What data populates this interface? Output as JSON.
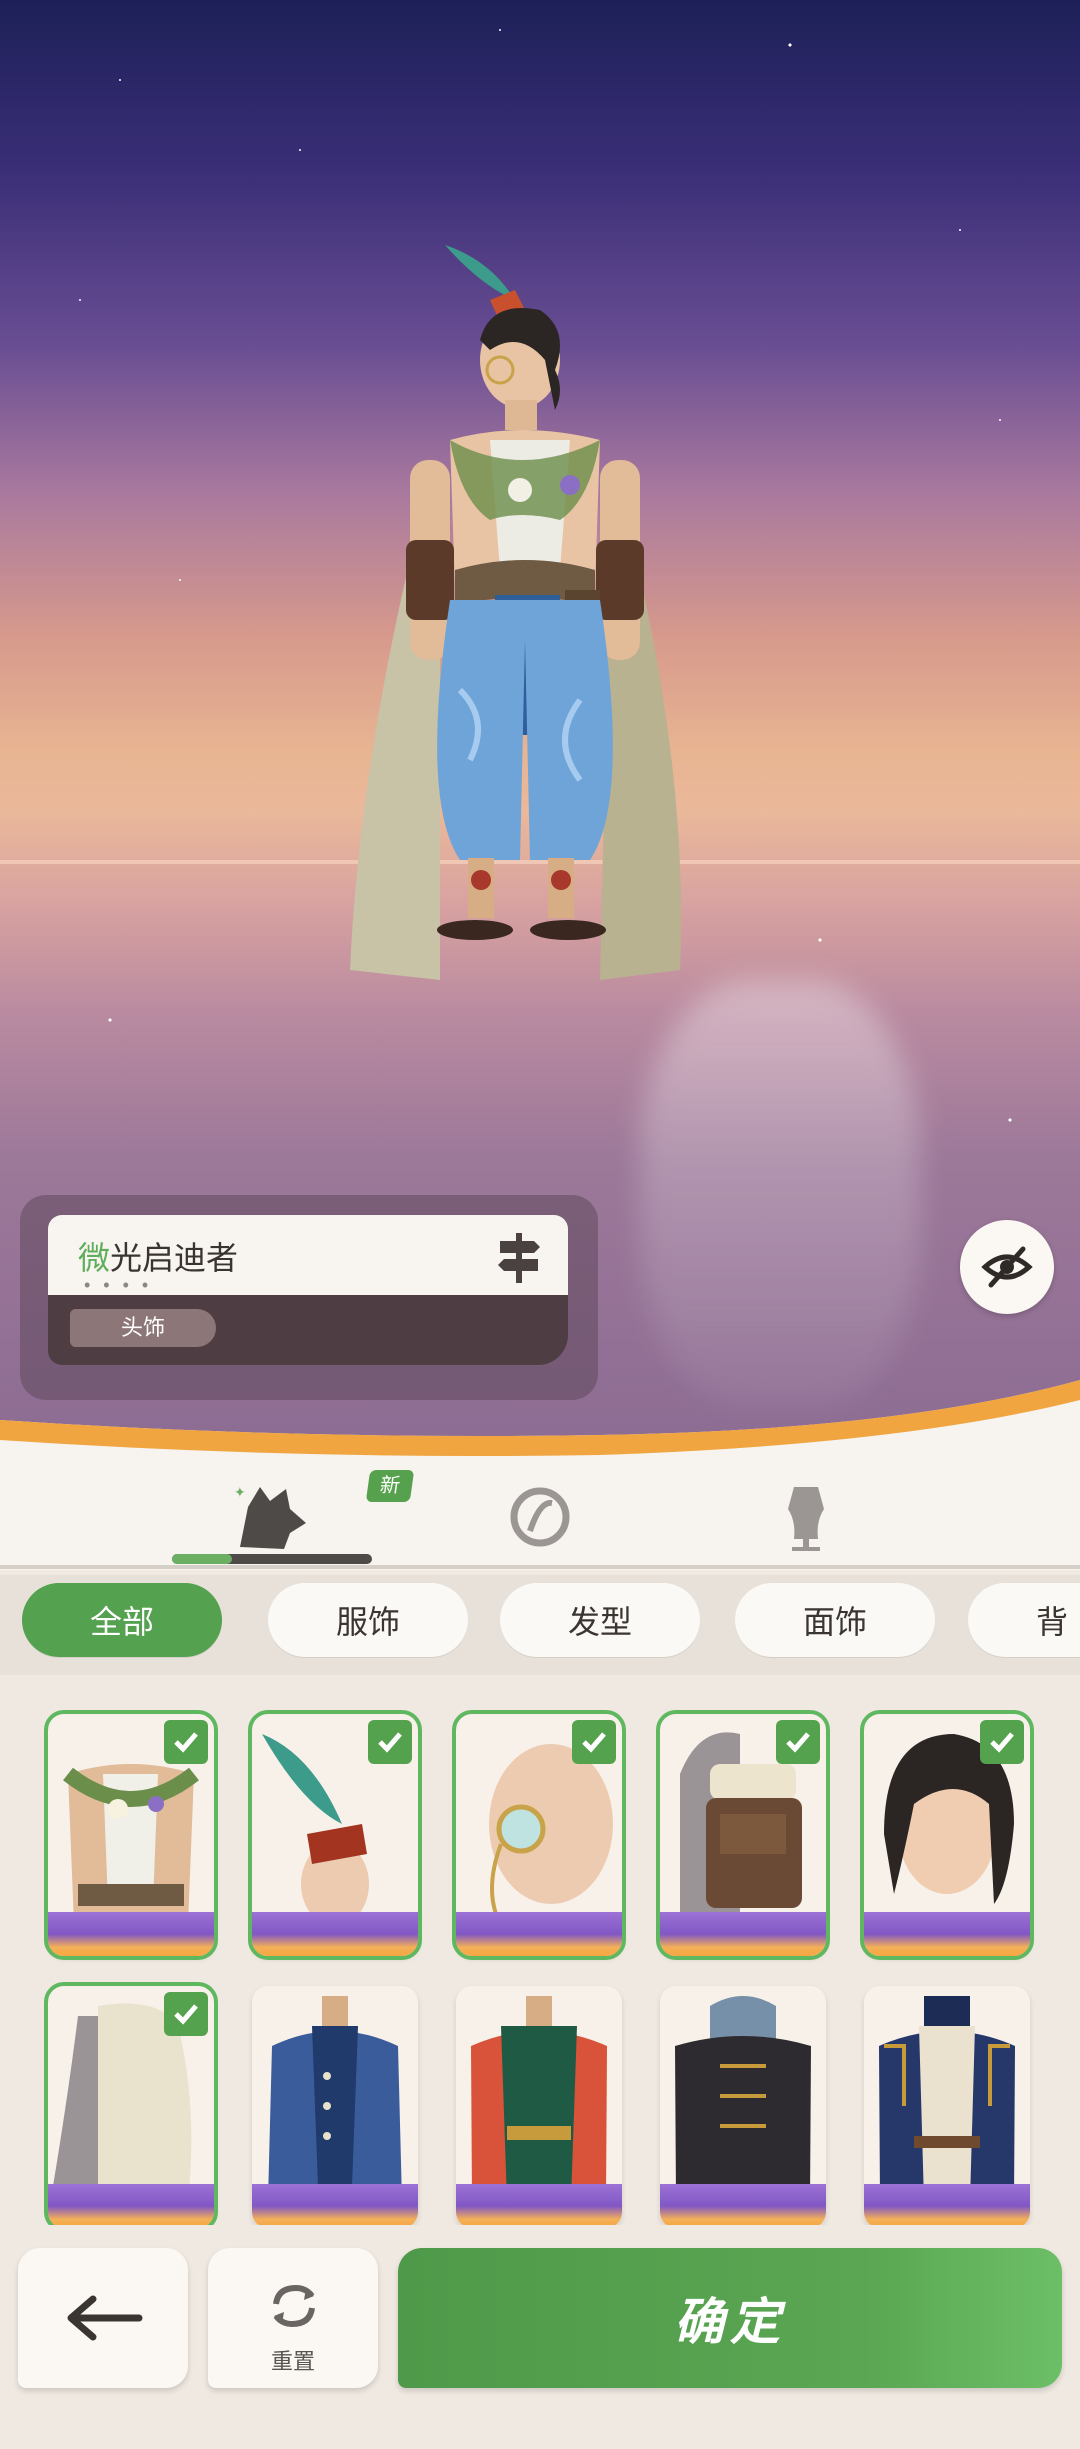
{
  "info_card": {
    "name_highlight": "微",
    "name_rest": "光启迪者",
    "dots": "• • • •",
    "tag": "头饰",
    "signpost_icon": "signpost-icon"
  },
  "eye_toggle": {
    "icon": "eye-hidden-icon"
  },
  "category_tabs": {
    "new_badge": "新",
    "items": [
      {
        "icon": "wolf-head-icon",
        "selected": true
      },
      {
        "icon": "makeup-palette-icon",
        "selected": false
      },
      {
        "icon": "mannequin-icon",
        "selected": false
      }
    ]
  },
  "filters": {
    "chips": [
      {
        "label": "全部",
        "active": true
      },
      {
        "label": "服饰",
        "active": false
      },
      {
        "label": "发型",
        "active": false
      },
      {
        "label": "面饰",
        "active": false
      },
      {
        "label": "背",
        "active": false
      }
    ]
  },
  "items": [
    {
      "name": "outfit-flower-vest",
      "selected": true
    },
    {
      "name": "headwear-feather-hat",
      "selected": true
    },
    {
      "name": "face-monocle",
      "selected": true
    },
    {
      "name": "back-backpack",
      "selected": true
    },
    {
      "name": "hair-black-swept",
      "selected": true
    },
    {
      "name": "cape-cream",
      "selected": true
    },
    {
      "name": "outfit-blue-coat",
      "selected": false
    },
    {
      "name": "outfit-green-robe",
      "selected": false
    },
    {
      "name": "outfit-dark-jacket",
      "selected": false
    },
    {
      "name": "outfit-navy-gold",
      "selected": false
    }
  ],
  "bottom": {
    "reset_label": "重置",
    "confirm_label": "确定"
  },
  "colors": {
    "accent_green": "#54a150",
    "badge_green": "#56a14d",
    "rarity_purple": "#8157c4",
    "rarity_orange": "#f6a640"
  }
}
